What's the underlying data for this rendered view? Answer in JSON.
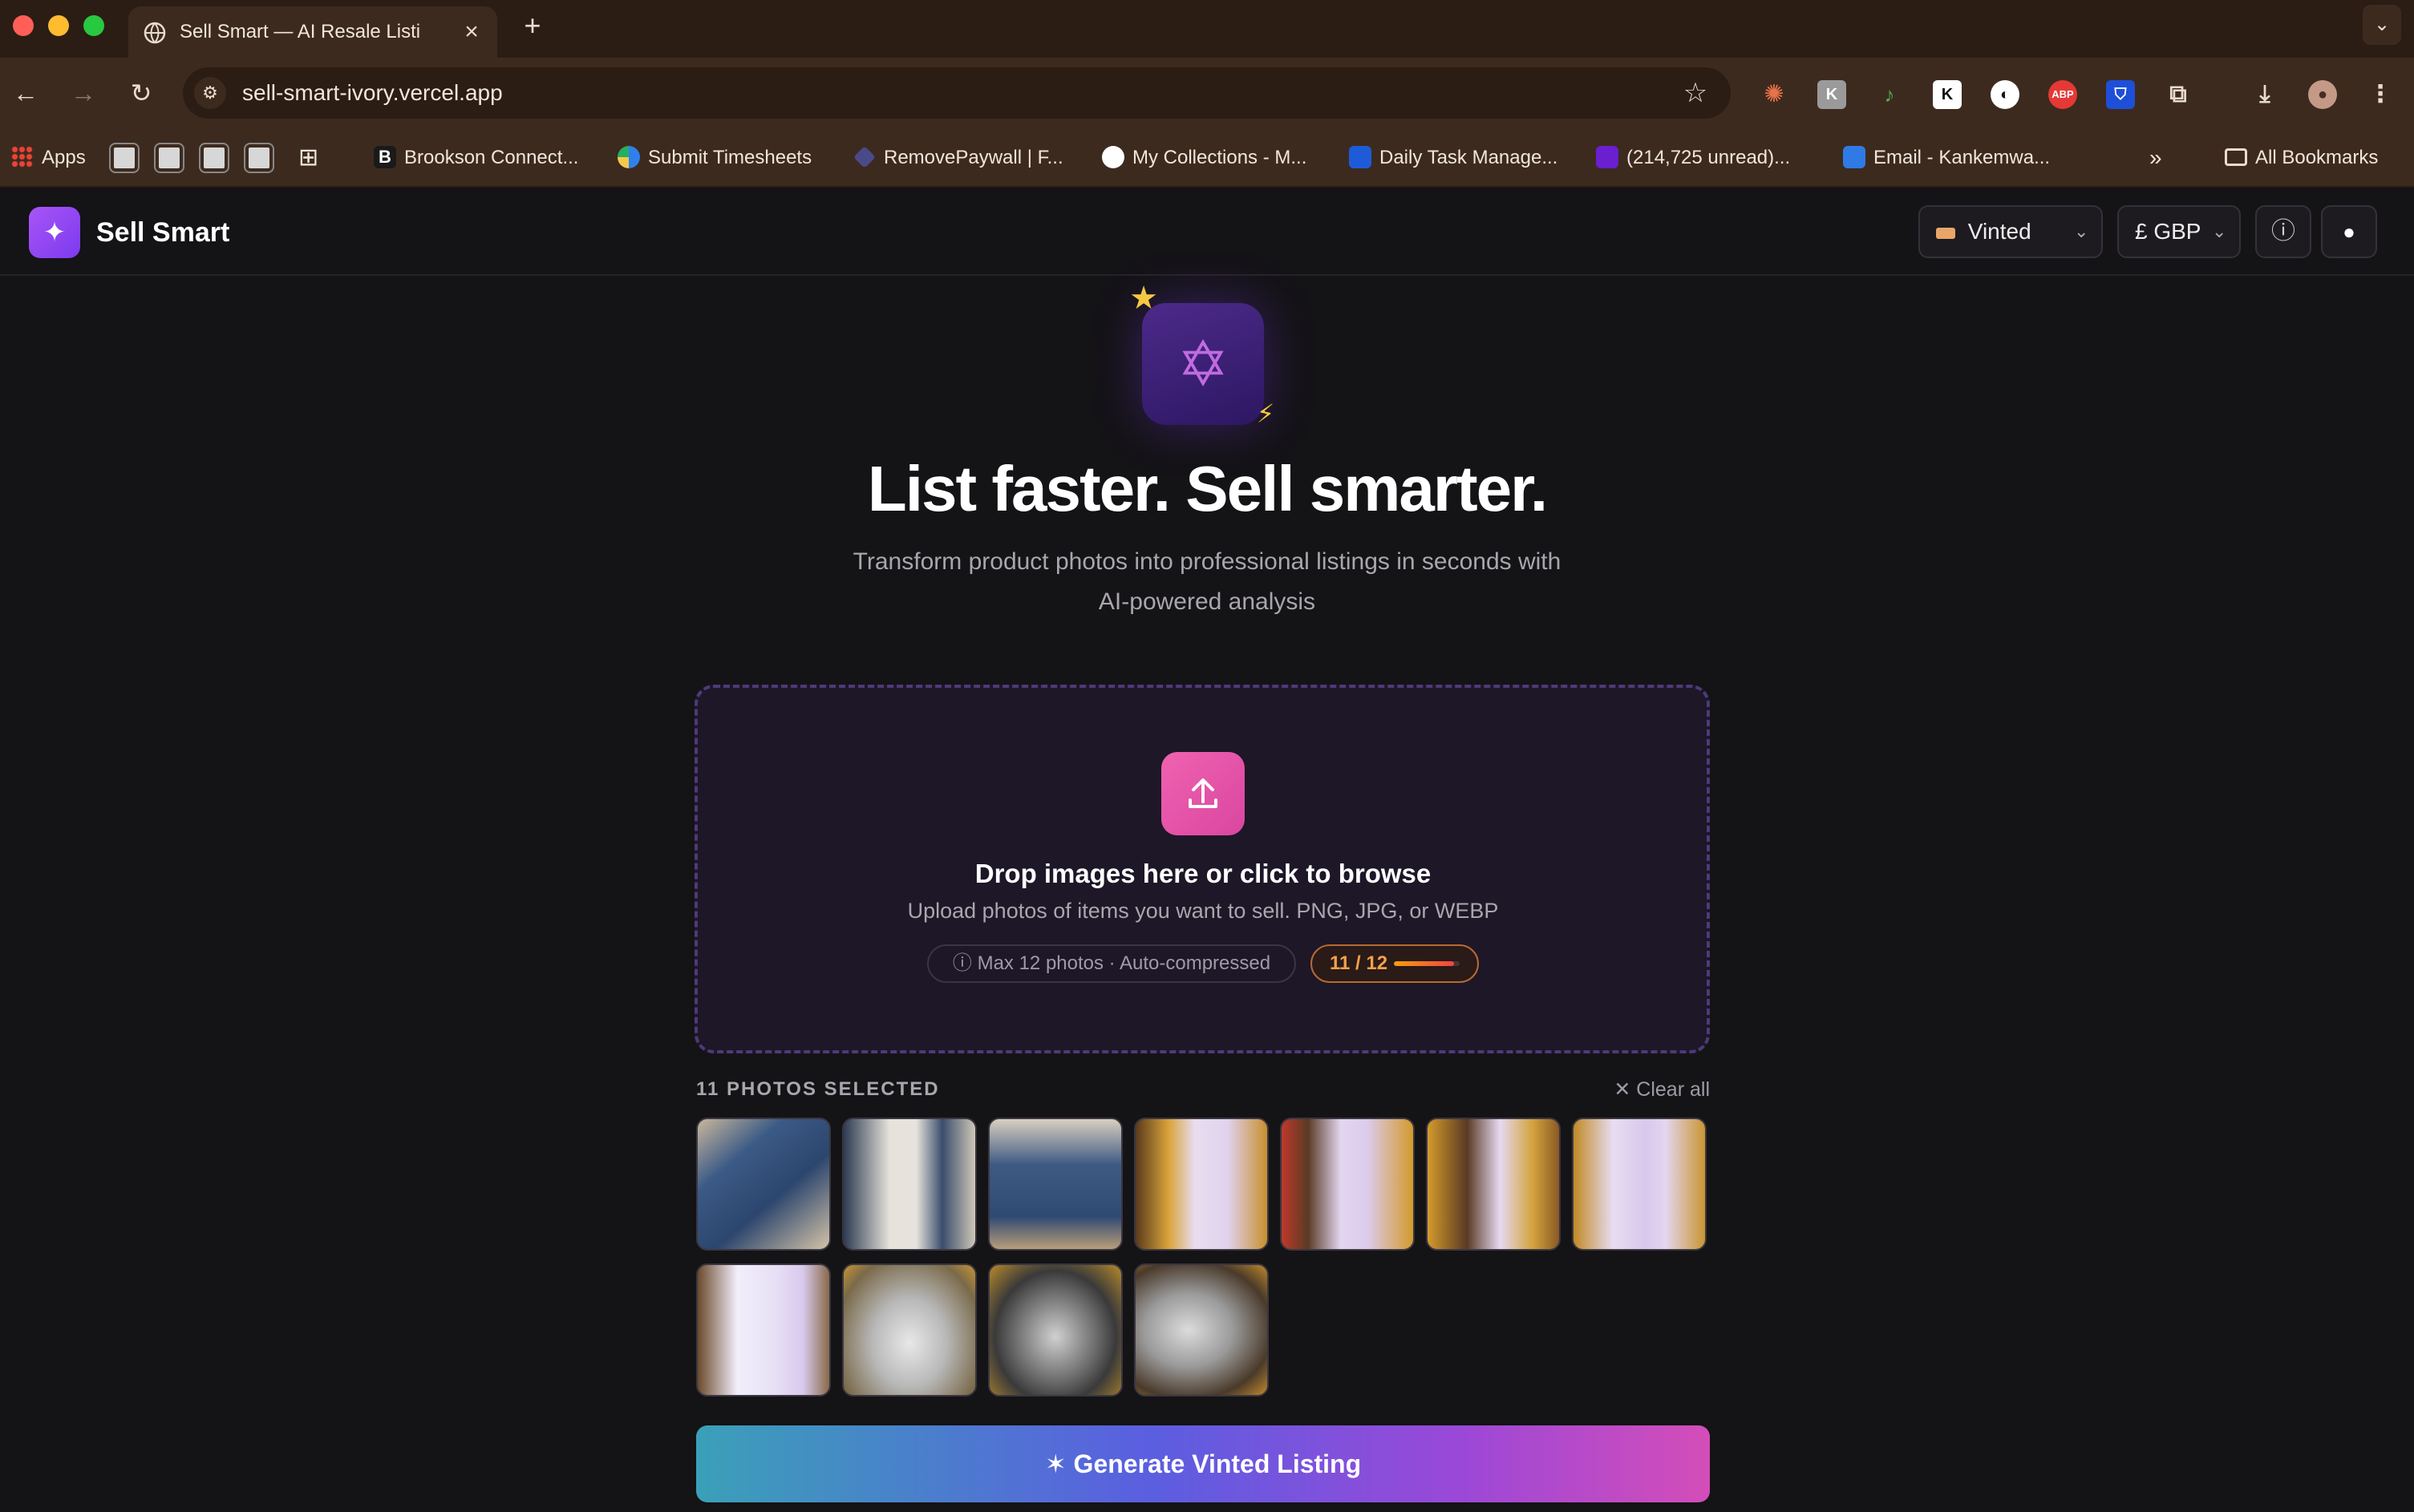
{
  "browser": {
    "tab_title": "Sell Smart — AI Resale Listing",
    "url": "sell-smart-ivory.vercel.app",
    "bookmarks": {
      "apps": "Apps",
      "brookson": "Brookson Connect...",
      "timesheets": "Submit Timesheets",
      "removepaywall": "RemovePaywall | F...",
      "collections": "My Collections - M...",
      "daily": "Daily Task Manage...",
      "unread": "(214,725 unread)...",
      "email": "Email - Kankemwa...",
      "all": "All Bookmarks"
    }
  },
  "header": {
    "brand": "Sell Smart",
    "platform": "Vinted",
    "currency": "£ GBP"
  },
  "hero": {
    "headline": "List faster. Sell smarter.",
    "subline": "Transform product photos into professional listings in seconds with AI-powered analysis"
  },
  "dropzone": {
    "title": "Drop images here or click to browse",
    "subtitle": "Upload photos of items you want to sell. PNG, JPG, or WEBP",
    "max_note": "ⓘ Max 12 photos · Auto-compressed",
    "count": "11 / 12",
    "count_fraction": 0.917
  },
  "photos": {
    "label": "11 PHOTOS SELECTED",
    "clear_all": "✕ Clear all",
    "items": [
      {
        "alt": "denim shorts front"
      },
      {
        "alt": "denim shorts waistband"
      },
      {
        "alt": "denim shorts back"
      },
      {
        "alt": "lavender tube in hand"
      },
      {
        "alt": "lavender tube close-up"
      },
      {
        "alt": "lavender tube on yellow"
      },
      {
        "alt": "two lavender tubes"
      },
      {
        "alt": "lavender tube and box"
      },
      {
        "alt": "clear sneakers top"
      },
      {
        "alt": "clear sneakers pair"
      },
      {
        "alt": "clear sneaker side"
      }
    ]
  },
  "generate_label": "✶  Generate Vinted Listing",
  "colors": {
    "accent": "#7c3aed",
    "pink": "#d946a0",
    "background": "#141316"
  }
}
